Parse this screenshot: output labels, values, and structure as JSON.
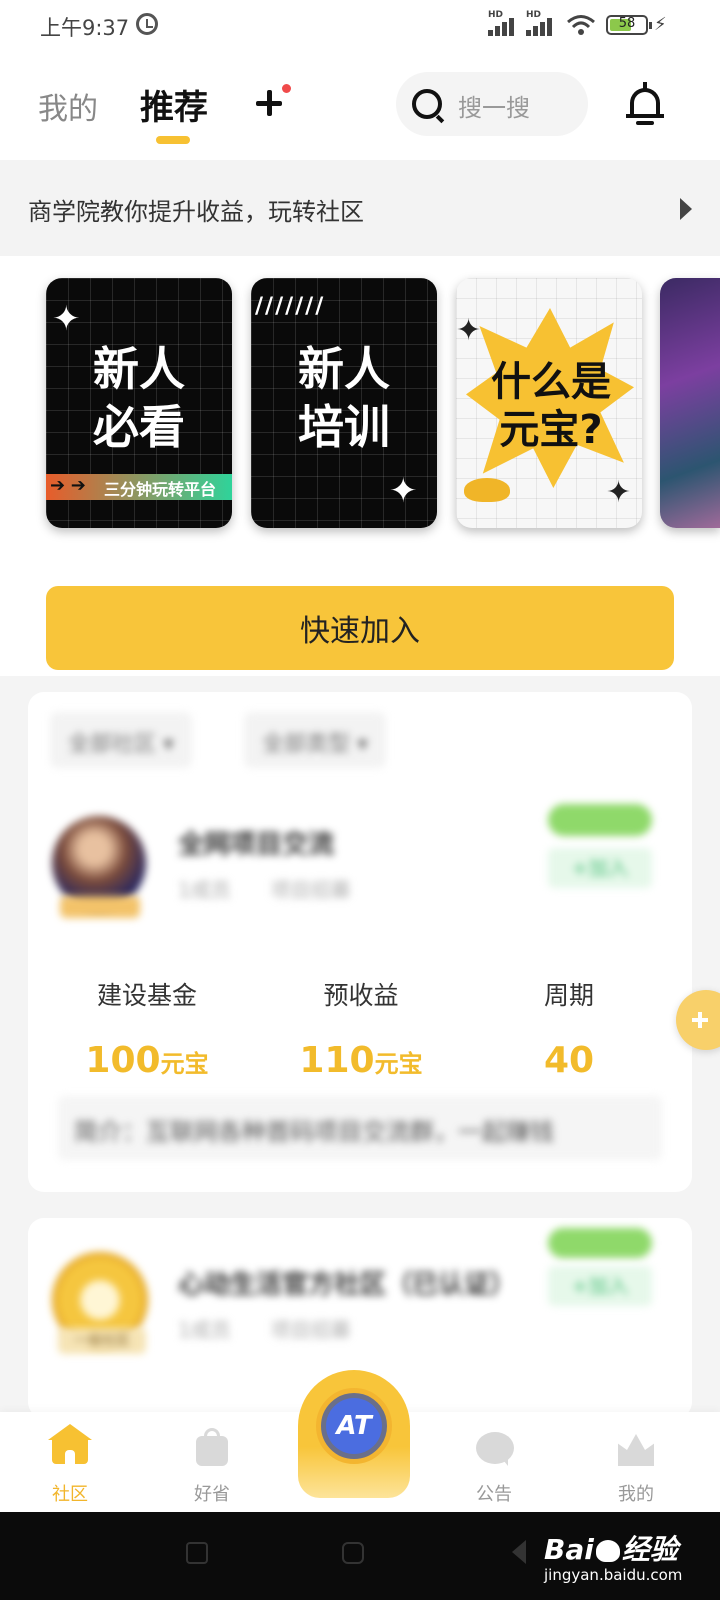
{
  "status_bar": {
    "time": "上午9:37",
    "battery": "58",
    "signal_label": "HD"
  },
  "header": {
    "tabs": [
      {
        "label": "我的",
        "active": false
      },
      {
        "label": "推荐",
        "active": true
      }
    ],
    "search_placeholder": "搜一搜"
  },
  "notice": {
    "text": "商学院教你提升收益，玩转社区"
  },
  "banners": [
    {
      "title_line1": "新人",
      "title_line2": "必看",
      "strip": "三分钟玩转平台"
    },
    {
      "title_line1": "新人",
      "title_line2": "培训"
    },
    {
      "title_line1": "什么是",
      "title_line2": "元宝?"
    }
  ],
  "quick_join": {
    "label": "快速加入"
  },
  "filters": [
    "全部社区",
    "全部类型"
  ],
  "community_card": {
    "title": "全网项目交流",
    "meta": "1成员　　项目招募",
    "stats": [
      {
        "label": "建设基金",
        "value": "100",
        "unit": "元宝"
      },
      {
        "label": "预收益",
        "value": "110",
        "unit": "元宝"
      },
      {
        "label": "周期",
        "value": "40",
        "unit": ""
      }
    ],
    "intro": "简介：互联网各种首码项目交流群，一起赚钱",
    "join_label": "+加入"
  },
  "community_card_2": {
    "title": "心动生活官方社区（已认证）",
    "meta": "1成员　　项目招募",
    "badge": "一级社区",
    "join_label": "+加入"
  },
  "bottom_nav": {
    "items": [
      {
        "label": "社区",
        "active": true
      },
      {
        "label": "好省",
        "active": false
      },
      {
        "label": "公告",
        "active": false
      },
      {
        "label": "我的",
        "active": false
      }
    ],
    "center_label": "AT"
  },
  "watermark": {
    "brand_left": "Bai",
    "brand_right": "经验",
    "url": "jingyan.baidu.com"
  },
  "colors": {
    "accent_yellow": "#f8c53a",
    "value_yellow": "#f2bb2b",
    "badge_red": "#f04a4a",
    "join_green": "#8fd96a"
  }
}
